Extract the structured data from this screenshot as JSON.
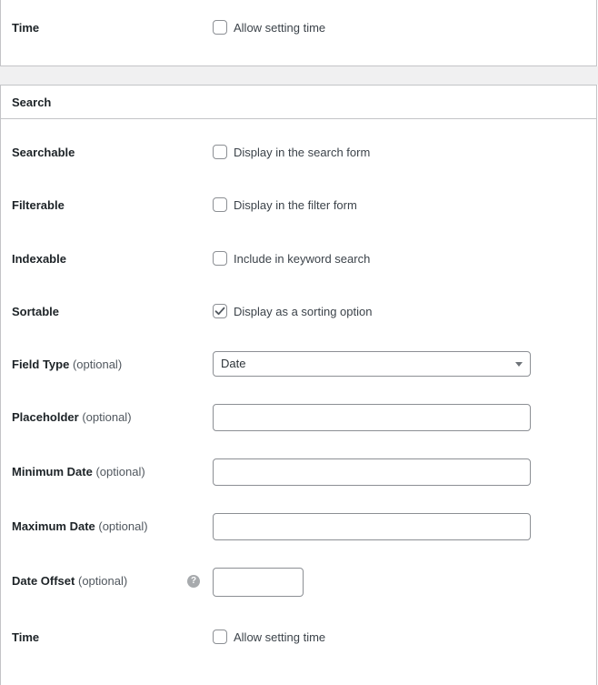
{
  "top_section": {
    "time": {
      "label": "Time",
      "checkbox_label": "Allow setting time",
      "checked": false
    }
  },
  "search": {
    "title": "Search",
    "searchable": {
      "label": "Searchable",
      "checkbox_label": "Display in the search form",
      "checked": false
    },
    "filterable": {
      "label": "Filterable",
      "checkbox_label": "Display in the filter form",
      "checked": false
    },
    "indexable": {
      "label": "Indexable",
      "checkbox_label": "Include in keyword search",
      "checked": false
    },
    "sortable": {
      "label": "Sortable",
      "checkbox_label": "Display as a sorting option",
      "checked": true
    },
    "field_type": {
      "label": "Field Type",
      "optional": "(optional)",
      "value": "Date"
    },
    "placeholder": {
      "label": "Placeholder",
      "optional": "(optional)",
      "value": ""
    },
    "minimum_date": {
      "label": "Minimum Date",
      "optional": "(optional)",
      "value": ""
    },
    "maximum_date": {
      "label": "Maximum Date",
      "optional": "(optional)",
      "value": ""
    },
    "date_offset": {
      "label": "Date Offset",
      "optional": "(optional)",
      "help_icon": "help-icon",
      "help_glyph": "?",
      "value": ""
    },
    "time": {
      "label": "Time",
      "checkbox_label": "Allow setting time",
      "checked": false
    }
  },
  "colors": {
    "border": "#c3c4c7",
    "page_gap": "#f0f0f1",
    "input_border": "#8c8f94",
    "check_mark": "#50575e",
    "help_icon": "#a7aaad"
  }
}
